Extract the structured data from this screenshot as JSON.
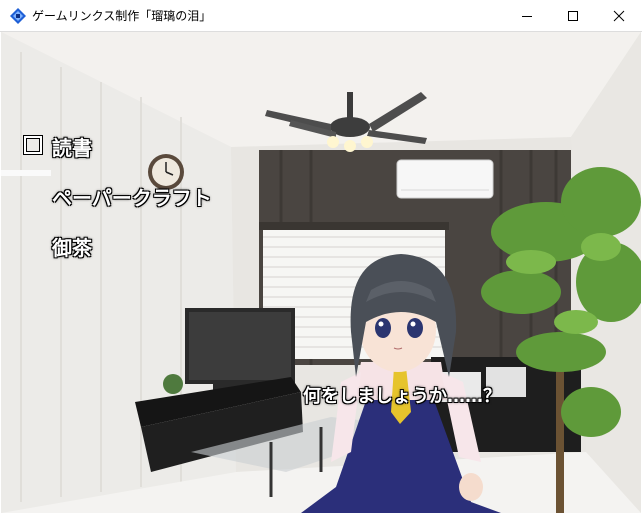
{
  "window": {
    "title": "ゲームリンクス制作「瑠璃の泪」",
    "controls": [
      "minimize",
      "maximize",
      "close"
    ]
  },
  "menu": {
    "items": [
      {
        "label": "読書",
        "selected": true
      },
      {
        "label": "ペーパークラフト",
        "selected": false
      },
      {
        "label": "御茶",
        "selected": false
      }
    ]
  },
  "dialog": {
    "text": "何をしましょうか……？"
  },
  "icons": [
    "app-diamond-icon",
    "minimize-icon",
    "maximize-icon",
    "close-icon"
  ],
  "colors": {
    "app_icon": "#1e5fd6",
    "menu_text": "#ffffff",
    "dress": "#2b2f7a",
    "hair": "#4a4f57",
    "tie": "#e6c42c"
  }
}
